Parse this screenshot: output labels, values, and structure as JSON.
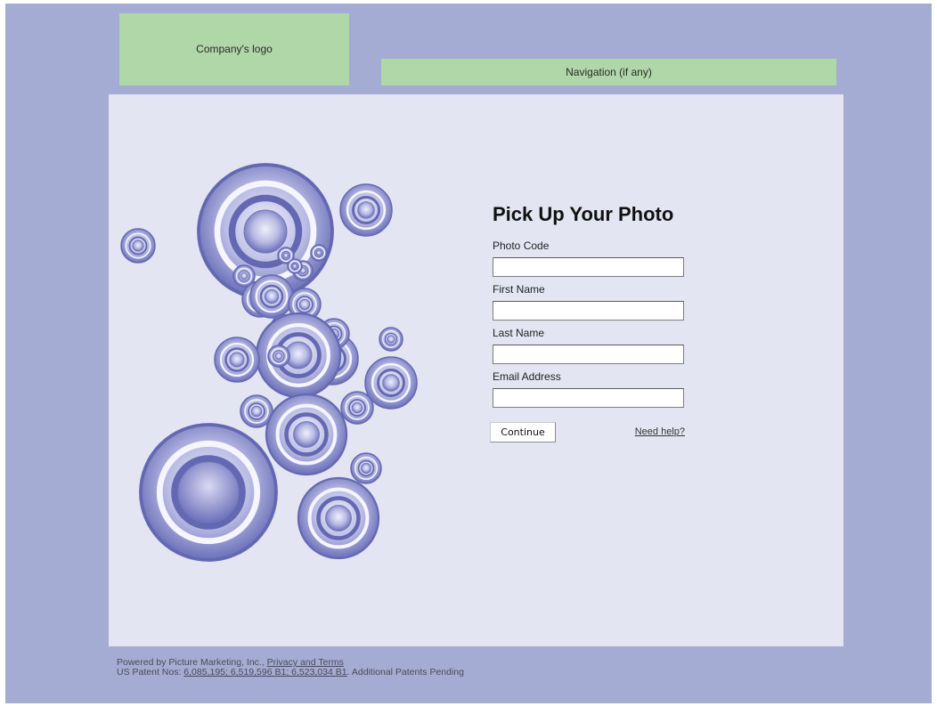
{
  "header": {
    "logo_text": "Company's logo",
    "nav_text": "Navigation (if any)"
  },
  "form": {
    "title": "Pick Up Your Photo",
    "fields": [
      {
        "label": "Photo Code",
        "value": ""
      },
      {
        "label": "First Name",
        "value": ""
      },
      {
        "label": "Last Name",
        "value": ""
      },
      {
        "label": "Email Address",
        "value": ""
      }
    ],
    "continue_label": "Continue",
    "help_label": "Need help?"
  },
  "footer": {
    "powered_by": "Powered by Picture Marketing, Inc.,",
    "privacy_link": "Privacy and Terms",
    "patent_prefix": "US Patent Nos:",
    "patent_links": "6,085,195; 6,519,596 B1; 6,523,034 B1",
    "patent_suffix": ". Additional Patents Pending"
  },
  "colors": {
    "page_background": "#a5acd3",
    "content_background": "#e3e5f2",
    "placeholder_green": "#b0d7a7",
    "ring_purple": "#7d7fc2"
  }
}
